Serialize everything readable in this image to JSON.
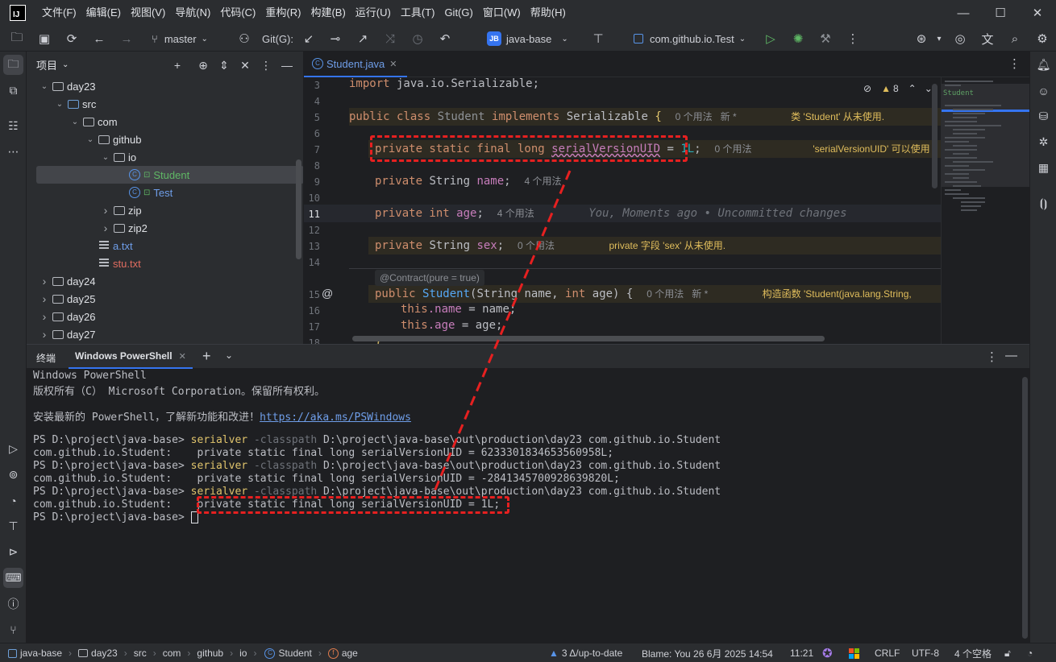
{
  "app": {
    "logo": "IJ"
  },
  "menu": [
    "文件(F)",
    "编辑(E)",
    "视图(V)",
    "导航(N)",
    "代码(C)",
    "重构(R)",
    "构建(B)",
    "运行(U)",
    "工具(T)",
    "Git(G)",
    "窗口(W)",
    "帮助(H)"
  ],
  "toolbar": {
    "branch": "master",
    "git_label": "Git(G):",
    "project_badge": "JB",
    "project": "java-base",
    "run_config": "com.github.io.Test"
  },
  "project_panel": {
    "title": "项目",
    "tree": [
      {
        "label": "day23",
        "depth": 1,
        "kind": "folder",
        "expanded": true
      },
      {
        "label": "src",
        "depth": 2,
        "kind": "src-folder",
        "expanded": true
      },
      {
        "label": "com",
        "depth": 3,
        "kind": "package",
        "expanded": true
      },
      {
        "label": "github",
        "depth": 4,
        "kind": "package",
        "expanded": true
      },
      {
        "label": "io",
        "depth": 5,
        "kind": "package",
        "expanded": true
      },
      {
        "label": "Student",
        "depth": 6,
        "kind": "class",
        "selected": true
      },
      {
        "label": "Test",
        "depth": 6,
        "kind": "class-run"
      },
      {
        "label": "zip",
        "depth": 5,
        "kind": "package",
        "expanded": false
      },
      {
        "label": "zip2",
        "depth": 5,
        "kind": "package",
        "expanded": false
      },
      {
        "label": "a.txt",
        "depth": 4,
        "kind": "text"
      },
      {
        "label": "stu.txt",
        "depth": 4,
        "kind": "text"
      },
      {
        "label": "day24",
        "depth": 1,
        "kind": "folder",
        "expanded": false
      },
      {
        "label": "day25",
        "depth": 1,
        "kind": "folder",
        "expanded": false
      },
      {
        "label": "day26",
        "depth": 1,
        "kind": "folder",
        "expanded": false
      },
      {
        "label": "day27",
        "depth": 1,
        "kind": "folder",
        "expanded": false
      }
    ]
  },
  "editor": {
    "tab": "Student.java",
    "warnings": "8",
    "minimap_label": "Student",
    "lines": {
      "n3": "3",
      "n4": "4",
      "n5": "5",
      "n6": "6",
      "n7": "7",
      "n8": "8",
      "n9": "9",
      "n10": "10",
      "n11": "11",
      "n12": "12",
      "n13": "13",
      "n14": "14",
      "n15": "15",
      "n16": "16",
      "n17": "17",
      "n18": "18"
    },
    "code": {
      "l3_kw": "import",
      "l3_rest": " java.io.Serializable;",
      "l5_kw1": "public class ",
      "l5_cls": "Student",
      "l5_kw2": " implements ",
      "l5_iface": "Serializable",
      "l5_brace": " {",
      "l5_hint": "0 个用法   新 *",
      "l5_warn": "类 'Student' 从未使用.",
      "l7_kw": "private static final long ",
      "l7_field": "serialVersionUID",
      "l7_eq": " = ",
      "l7_num": "1L",
      "l7_semi": ";",
      "l7_hint": "0 个用法",
      "l7_warn": "'serialVersionUID' 可以使用 '",
      "l9_kw": "private ",
      "l9_type": "String ",
      "l9_field": "name",
      "l9_semi": ";",
      "l9_hint": "4 个用法",
      "l11_kw": "private int ",
      "l11_field": "age",
      "l11_semi": ";",
      "l11_hint": "4 个用法",
      "l11_blame": "You, Moments ago • Uncommitted changes",
      "l13_kw": "private ",
      "l13_type": "String ",
      "l13_field": "sex",
      "l13_semi": ";",
      "l13_hint": "0 个用法",
      "l13_warn": "private 字段 'sex' 从未使用.",
      "contract": "@Contract(pure = true)",
      "l15_kw": "public ",
      "l15_fn": "Student",
      "l15_args": "(String name, ",
      "l15_kw2": "int",
      "l15_args2": " age) {",
      "l15_hint": "0 个用法   新 *",
      "l15_warn": "构造函数 'Student(java.lang.String,",
      "l16_kw": "this",
      "l16_field": ".name",
      "l16_rest": " = name;",
      "l17_kw": "this",
      "l17_field": ".age",
      "l17_rest": " = age;",
      "l18": "}"
    }
  },
  "terminal": {
    "tab_label": "终端",
    "session": "Windows PowerShell",
    "header1": "Windows PowerShell",
    "header2": "版权所有（C） Microsoft Corporation。保留所有权利。",
    "install_text": "安装最新的 PowerShell，了解新功能和改进！",
    "install_link": "https://aka.ms/PSWindows",
    "prompt": "PS D:\\project\\java-base> ",
    "cmd": "serialver",
    "flag": " -classpath",
    "args": " D:\\project\\java-base\\out\\production\\day23 com.github.io.Student",
    "out_prefix": "com.github.io.Student:    ",
    "out1": "private static final long serialVersionUID = 6233301834653560958L;",
    "out2": "private static final long serialVersionUID = -2841345700928639820L;",
    "out3": "private static final long serialVersionUID = 1L;"
  },
  "statusbar": {
    "crumbs": [
      "java-base",
      "day23",
      "src",
      "com",
      "github",
      "io",
      "Student",
      "age"
    ],
    "vcs": "3 Δ/up-to-date",
    "blame": "Blame: You 26 6月 2025 14:54",
    "position": "11:21",
    "line_sep": "CRLF",
    "encoding": "UTF-8",
    "indent": "4 个空格"
  },
  "colors": {
    "background": "#1e1f22",
    "panel": "#2b2d30",
    "accent": "#3574f0",
    "annotation": "#e62020"
  }
}
